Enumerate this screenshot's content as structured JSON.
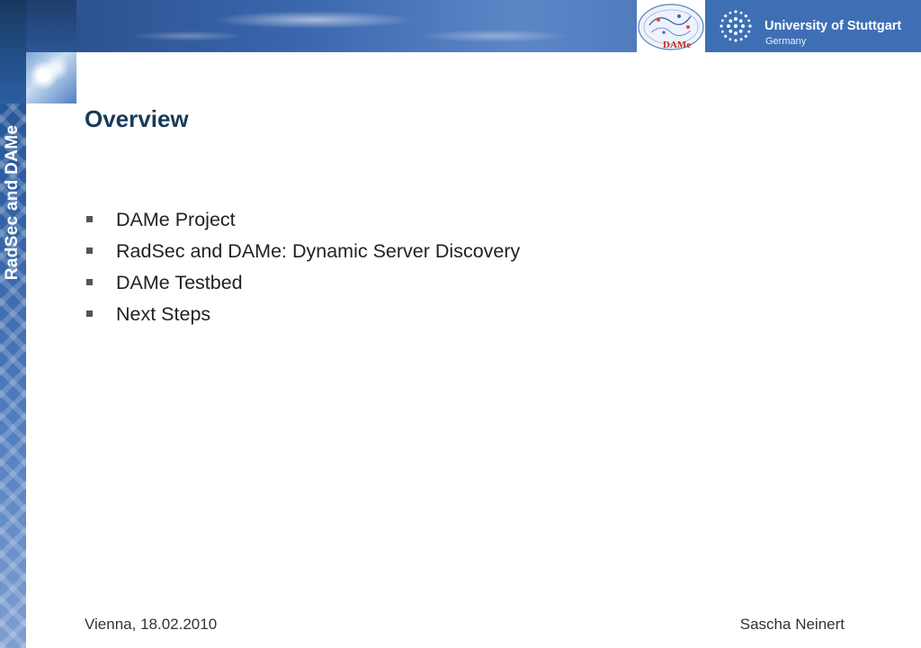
{
  "sidebar": {
    "title": "RadSec and DAMe"
  },
  "header": {
    "dame_logo_text": "DAMe",
    "university_name": "University of Stuttgart",
    "university_country": "Germany"
  },
  "slide": {
    "title": "Overview",
    "bullets": [
      "DAMe Project",
      "RadSec and DAMe: Dynamic Server Discovery",
      "DAMe Testbed",
      "Next Steps"
    ]
  },
  "footer": {
    "left": "Vienna, 18.02.2010",
    "right": "Sascha Neinert"
  },
  "colors": {
    "band_blue": "#3e6fb5",
    "title_color": "#1b3a5c",
    "bullet_color": "#555555"
  },
  "icons": [
    "dame-logo-icon",
    "university-logo-icon",
    "bullet-square-icon"
  ]
}
